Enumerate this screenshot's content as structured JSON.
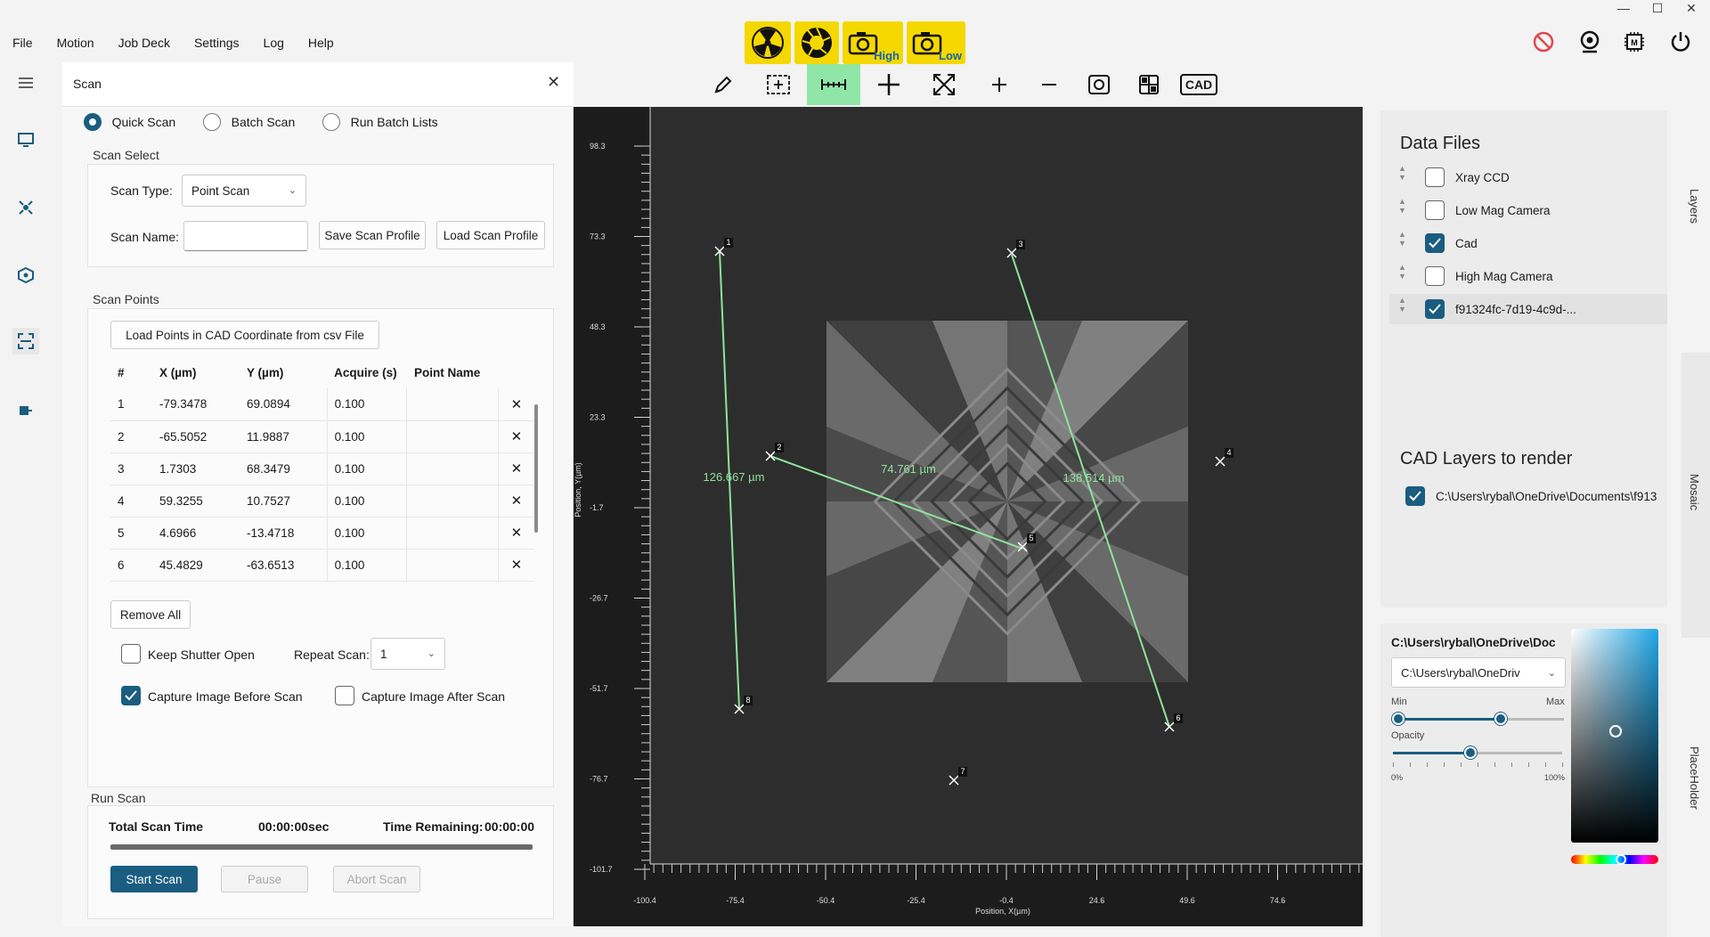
{
  "menu": [
    "File",
    "Motion",
    "Job Deck",
    "Settings",
    "Log",
    "Help"
  ],
  "status_icons": [
    {
      "name": "radiation-icon",
      "label": ""
    },
    {
      "name": "shutter-icon",
      "label": ""
    },
    {
      "name": "camera-high-icon",
      "label": "High"
    },
    {
      "name": "camera-low-icon",
      "label": "Low"
    }
  ],
  "scan_panel": {
    "title": "Scan",
    "modes": [
      "Quick Scan",
      "Batch Scan",
      "Run Batch Lists"
    ],
    "selected_mode": "Quick Scan",
    "scan_select": {
      "title": "Scan Select",
      "scan_type_label": "Scan Type:",
      "scan_type_value": "Point Scan",
      "scan_name_label": "Scan Name:",
      "scan_name_value": "",
      "save_profile": "Save Scan Profile",
      "load_profile": "Load Scan Profile"
    },
    "scan_points": {
      "title": "Scan Points",
      "load_button": "Load Points in CAD Coordinate from csv File",
      "columns": [
        "#",
        "X (µm)",
        "Y (µm)",
        "Acquire (s)",
        "Point Name"
      ],
      "rows": [
        [
          "1",
          "-79.3478",
          "69.0894",
          "0.100",
          ""
        ],
        [
          "2",
          "-65.5052",
          "11.9887",
          "0.100",
          ""
        ],
        [
          "3",
          "1.7303",
          "68.3479",
          "0.100",
          ""
        ],
        [
          "4",
          "59.3255",
          "10.7527",
          "0.100",
          ""
        ],
        [
          "5",
          "4.6966",
          "-13.4718",
          "0.100",
          ""
        ],
        [
          "6",
          "45.4829",
          "-63.6513",
          "0.100",
          ""
        ]
      ],
      "remove_all": "Remove All",
      "keep_shutter_open": "Keep Shutter Open",
      "keep_shutter_checked": false,
      "repeat_scan_label": "Repeat Scan:",
      "repeat_scan_value": "1",
      "capture_before": "Capture Image Before Scan",
      "capture_before_checked": true,
      "capture_after": "Capture Image After Scan",
      "capture_after_checked": false
    },
    "run_scan": {
      "title": "Run Scan",
      "total_time_label": "Total Scan Time",
      "total_time_value": "00:00:00sec",
      "remaining_label": "Time Remaining:",
      "remaining_value": "00:00:00",
      "progress": 0,
      "start": "Start Scan",
      "pause": "Pause",
      "abort": "Abort Scan"
    }
  },
  "toolbar": {
    "items": [
      "pencil-icon",
      "select-region-icon",
      "measure-icon",
      "crosshair-icon",
      "fit-icon",
      "zoom-in-icon",
      "zoom-out-icon",
      "screenshot-icon",
      "grid-icon",
      "cad-button"
    ],
    "active": "measure-icon",
    "cad_label": "CAD"
  },
  "plot": {
    "y_ticks": [
      "98.3",
      "73.3",
      "48.3",
      "23.3",
      "-1.7",
      "-26.7",
      "-51.7",
      "-76.7",
      "-101.7"
    ],
    "x_ticks": [
      "-100.4",
      "-75.4",
      "-50.4",
      "-25.4",
      "-0.4",
      "24.6",
      "49.6",
      "74.6"
    ],
    "y_label": "Position, Y(µm)",
    "x_label": "Position, X(µm)",
    "measurements": [
      "126.667 µm",
      "74.761 µm",
      "138.514 µm"
    ],
    "point_labels": [
      "1",
      "2",
      "3",
      "4",
      "5",
      "6",
      "7",
      "8"
    ]
  },
  "data_files": {
    "title": "Data Files",
    "items": [
      {
        "label": "Xray CCD",
        "checked": false
      },
      {
        "label": "Low Mag Camera",
        "checked": false
      },
      {
        "label": "Cad",
        "checked": true
      },
      {
        "label": "High Mag Camera",
        "checked": false
      },
      {
        "label": "f91324fc-7d19-4c9d-...",
        "checked": true
      }
    ]
  },
  "cad_layers": {
    "title": "CAD Layers to render",
    "items": [
      {
        "label": "C:\\Users\\rybal\\OneDrive\\Documents\\f913",
        "checked": true
      }
    ]
  },
  "layer_style": {
    "path_title": "C:\\Users\\rybal\\OneDrive\\Doc",
    "dropdown_value": "C:\\Users\\rybal\\OneDriv",
    "min_label": "Min",
    "max_label": "Max",
    "opacity_label": "Opacity",
    "opacity_min": "0%",
    "opacity_max": "100%",
    "range_min": 0,
    "range_max": 0.62,
    "opacity": 0.46
  },
  "side_tabs": [
    "Layers",
    "Mosaic",
    "PlaceHolder"
  ]
}
